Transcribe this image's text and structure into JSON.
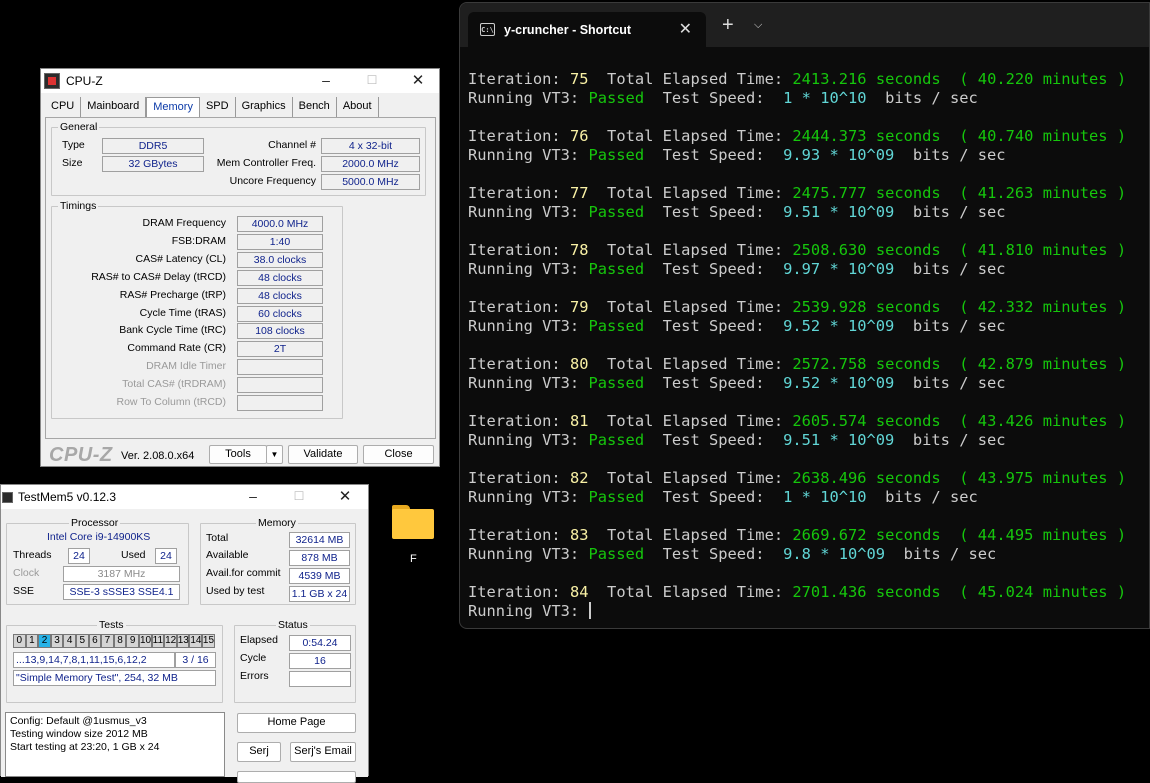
{
  "terminal": {
    "tab_title": "y-cruncher - Shortcut",
    "tab_icon_text": "C:\\",
    "close_glyph": "✕",
    "new_tab_glyph": "+",
    "dropdown_glyph": "⌄",
    "labels": {
      "iteration": "Iteration:",
      "elapsed": "Total Elapsed Time:",
      "running": "Running VT3:",
      "speed": "Test Speed:",
      "seconds": "seconds",
      "minutes": "minutes )",
      "open_paren": "(",
      "bits": "bits / sec"
    },
    "blocks": [
      {
        "iter": "75",
        "secs": "2413.216",
        "mins": "40.220",
        "status": "Passed",
        "speed": "1 * 10^10"
      },
      {
        "iter": "76",
        "secs": "2444.373",
        "mins": "40.740",
        "status": "Passed",
        "speed": "9.93 * 10^09"
      },
      {
        "iter": "77",
        "secs": "2475.777",
        "mins": "41.263",
        "status": "Passed",
        "speed": "9.51 * 10^09"
      },
      {
        "iter": "78",
        "secs": "2508.630",
        "mins": "41.810",
        "status": "Passed",
        "speed": "9.97 * 10^09"
      },
      {
        "iter": "79",
        "secs": "2539.928",
        "mins": "42.332",
        "status": "Passed",
        "speed": "9.52 * 10^09"
      },
      {
        "iter": "80",
        "secs": "2572.758",
        "mins": "42.879",
        "status": "Passed",
        "speed": "9.52 * 10^09"
      },
      {
        "iter": "81",
        "secs": "2605.574",
        "mins": "43.426",
        "status": "Passed",
        "speed": "9.51 * 10^09"
      },
      {
        "iter": "82",
        "secs": "2638.496",
        "mins": "43.975",
        "status": "Passed",
        "speed": "1 * 10^10"
      },
      {
        "iter": "83",
        "secs": "2669.672",
        "mins": "44.495",
        "status": "Passed",
        "speed": "9.8 * 10^09"
      }
    ],
    "last": {
      "iter": "84",
      "secs": "2701.436",
      "mins": "45.024"
    }
  },
  "cpuz": {
    "title": "CPU-Z",
    "tabs": [
      "CPU",
      "Mainboard",
      "Memory",
      "SPD",
      "Graphics",
      "Bench",
      "About"
    ],
    "active_tab": "Memory",
    "general": {
      "title": "General",
      "type_label": "Type",
      "type_value": "DDR5",
      "size_label": "Size",
      "size_value": "32 GBytes",
      "channel_label": "Channel #",
      "channel_value": "4 x 32-bit",
      "memctrl_label": "Mem Controller Freq.",
      "memctrl_value": "2000.0 MHz",
      "uncore_label": "Uncore Frequency",
      "uncore_value": "5000.0 MHz"
    },
    "timings": {
      "title": "Timings",
      "rows": [
        {
          "label": "DRAM Frequency",
          "value": "4000.0 MHz",
          "dim": false
        },
        {
          "label": "FSB:DRAM",
          "value": "1:40",
          "dim": false
        },
        {
          "label": "CAS# Latency (CL)",
          "value": "38.0 clocks",
          "dim": false
        },
        {
          "label": "RAS# to CAS# Delay (tRCD)",
          "value": "48 clocks",
          "dim": false
        },
        {
          "label": "RAS# Precharge (tRP)",
          "value": "48 clocks",
          "dim": false
        },
        {
          "label": "Cycle Time (tRAS)",
          "value": "60 clocks",
          "dim": false
        },
        {
          "label": "Bank Cycle Time (tRC)",
          "value": "108 clocks",
          "dim": false
        },
        {
          "label": "Command Rate (CR)",
          "value": "2T",
          "dim": false
        },
        {
          "label": "DRAM Idle Timer",
          "value": "",
          "dim": true
        },
        {
          "label": "Total CAS# (tRDRAM)",
          "value": "",
          "dim": true
        },
        {
          "label": "Row To Column (tRCD)",
          "value": "",
          "dim": true
        }
      ]
    },
    "footer": {
      "logo": "CPU-Z",
      "version": "Ver. 2.08.0.x64",
      "tools": "Tools",
      "tools_arrow": "▼",
      "validate": "Validate",
      "close": "Close"
    }
  },
  "testmem5": {
    "title": "TestMem5 v0.12.3",
    "processor": {
      "title": "Processor",
      "name": "Intel Core i9-14900KS",
      "threads_label": "Threads",
      "threads_value": "24",
      "used_label": "Used",
      "used_value": "24",
      "clock_label": "Clock",
      "clock_value": "3187 MHz",
      "sse_label": "SSE",
      "sse_value": "SSE-3 sSSE3 SSE4.1"
    },
    "memory": {
      "title": "Memory",
      "total_label": "Total",
      "total_value": "32614 MB",
      "available_label": "Available",
      "available_value": "878 MB",
      "commit_label": "Avail.for commit",
      "commit_value": "4539 MB",
      "used_label": "Used by test",
      "used_value": "1.1 GB x 24"
    },
    "tests": {
      "title": "Tests",
      "cells": [
        "0",
        "1",
        "2",
        "3",
        "4",
        "5",
        "6",
        "7",
        "8",
        "9",
        "10",
        "11",
        "12",
        "13",
        "14",
        "15"
      ],
      "active_cell": 2,
      "sequence": "...13,9,14,7,8,1,11,15,6,12,2",
      "progress": "3 / 16",
      "current": "\"Simple Memory Test\", 254, 32 MB"
    },
    "status": {
      "title": "Status",
      "elapsed_label": "Elapsed",
      "elapsed_value": "0:54.24",
      "cycle_label": "Cycle",
      "cycle_value": "16",
      "errors_label": "Errors",
      "errors_value": ""
    },
    "log_lines": [
      "Config: Default @1usmus_v3",
      "Testing window size 2012 MB",
      "Start testing at 23:20, 1 GB x 24"
    ],
    "buttons": {
      "home": "Home Page",
      "serj": "Serj",
      "serj_email": "Serj's Email"
    }
  },
  "desktop": {
    "folder_label": "F"
  }
}
